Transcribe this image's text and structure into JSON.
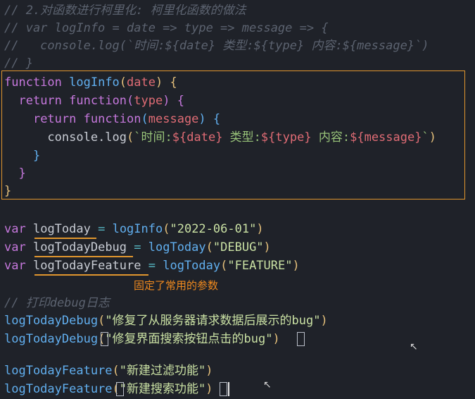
{
  "comments": {
    "line1": "// 2.对函数进行柯里化: 柯里化函数的做法",
    "line2": "// var logInfo = date => type => message => {",
    "line3": "//   console.log(`时间:${date} 类型:${type} 内容:${message}`)",
    "line4": "// }",
    "print_debug": "// 打印debug日志"
  },
  "code": {
    "kw_function": "function",
    "kw_return": "return",
    "kw_var": "var",
    "fn_logInfo": "logInfo",
    "param_date": "date",
    "param_type": "type",
    "param_message": "message",
    "console_log": "console.log",
    "tpl_time": "`时间:",
    "tpl_type": " 类型:",
    "tpl_content": " 内容:",
    "tpl_end": "`",
    "var_logToday": "logToday",
    "var_logTodayDebug": "logTodayDebug",
    "var_logTodayFeature": "logTodayFeature",
    "str_date": "\"2022-06-01\"",
    "str_debug": "\"DEBUG\"",
    "str_feature": "\"FEATURE\"",
    "call1_str": "\"修复了从服务器请求数据后展示的bug\"",
    "call2_str": "\"修复界面搜索按钮点击的bug\"",
    "call3_str": "\"新建过滤功能\"",
    "call4_str": "\"新建搜索功能\""
  },
  "annotation": {
    "note": "固定了常用的参数",
    "accent_color": "#e0962e"
  }
}
